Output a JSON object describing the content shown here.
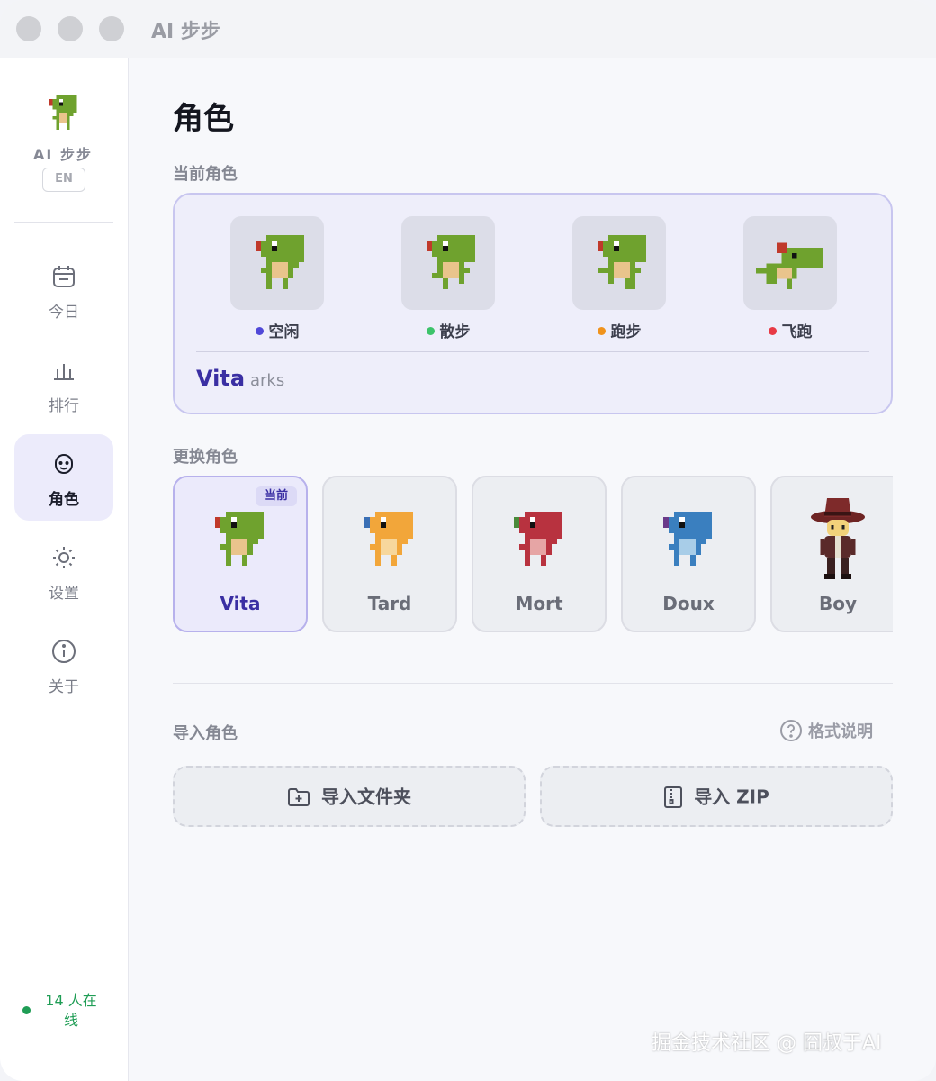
{
  "window": {
    "title": "AI 步步"
  },
  "sidebar": {
    "brand": "AI 步步",
    "lang_button": "EN",
    "nav": [
      {
        "label": "今日",
        "icon": "calendar-icon"
      },
      {
        "label": "排行",
        "icon": "bar-chart-icon"
      },
      {
        "label": "角色",
        "icon": "face-icon",
        "active": true
      },
      {
        "label": "设置",
        "icon": "sun-icon"
      },
      {
        "label": "关于",
        "icon": "info-icon"
      }
    ],
    "online_text": "14 人在线"
  },
  "main": {
    "title": "角色",
    "current_section_label": "当前角色",
    "current": {
      "states": [
        {
          "label": "空闲",
          "dot_color": "#5048d8"
        },
        {
          "label": "散步",
          "dot_color": "#3cc36a"
        },
        {
          "label": "跑步",
          "dot_color": "#f0931c"
        },
        {
          "label": "飞跑",
          "dot_color": "#e83a45"
        }
      ],
      "name": "Vita",
      "author": "arks"
    },
    "switch_section_label": "更换角色",
    "current_badge": "当前",
    "characters": [
      {
        "name": "Vita",
        "body_color": "#6fa22e",
        "selected": true
      },
      {
        "name": "Tard",
        "body_color": "#f2a63a"
      },
      {
        "name": "Mort",
        "body_color": "#b8323f"
      },
      {
        "name": "Doux",
        "body_color": "#3a7fbf"
      },
      {
        "name": "Boy",
        "body_color": "#7a2e2e"
      }
    ],
    "import_section_label": "导入角色",
    "help_link": "格式说明",
    "import_folder": "导入文件夹",
    "import_zip": "导入 ZIP"
  },
  "watermark": "掘金技术社区 @ 囧叔于AI",
  "colors": {
    "accent": "#3a2fa3",
    "online": "#1f9d55"
  }
}
